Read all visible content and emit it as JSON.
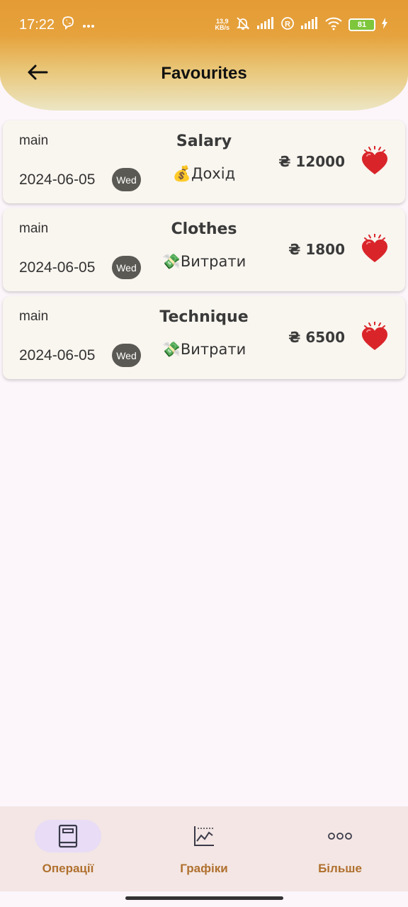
{
  "status_bar": {
    "time": "17:22",
    "net_speed_value": "13,9",
    "net_speed_unit": "KB/s",
    "battery": "81"
  },
  "header": {
    "title": "Favourites"
  },
  "favourites": [
    {
      "account": "main",
      "date": "2024-06-05",
      "day": "Wed",
      "name": "Salary",
      "type": "💰Дохід",
      "amount": "₴ 12000"
    },
    {
      "account": "main",
      "date": "2024-06-05",
      "day": "Wed",
      "name": "Clothes",
      "type": "💸Витрати",
      "amount": "₴ 1800"
    },
    {
      "account": "main",
      "date": "2024-06-05",
      "day": "Wed",
      "name": "Technique",
      "type": "💸Витрати",
      "amount": "₴ 6500"
    }
  ],
  "bottom_nav": {
    "items": [
      {
        "label": "Операції",
        "icon": "book-icon",
        "active": true
      },
      {
        "label": "Графіки",
        "icon": "chart-icon",
        "active": false
      },
      {
        "label": "Більше",
        "icon": "more-icon",
        "active": false
      }
    ]
  },
  "colors": {
    "header_top": "#e49b35",
    "header_bottom": "#ece6c4",
    "card_bg": "#f9f5ef",
    "nav_label": "#b0702e",
    "heart": "#d9252a"
  }
}
